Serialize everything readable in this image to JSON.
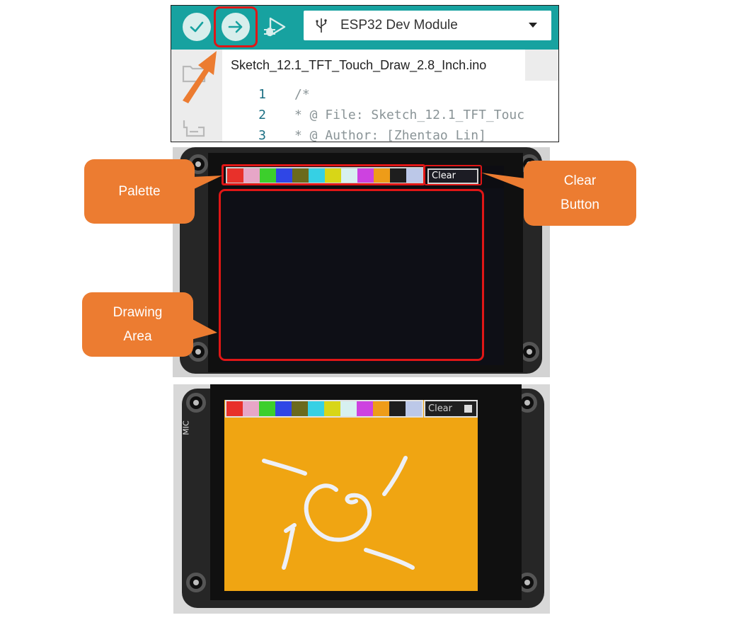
{
  "ide": {
    "board": "ESP32 Dev Module",
    "file_tab": "Sketch_12.1_TFT_Touch_Draw_2.8_Inch.ino",
    "code_lines": [
      {
        "num": "1",
        "text": "/*"
      },
      {
        "num": "2",
        "text": "* @ File:   Sketch_12.1_TFT_Touc"
      },
      {
        "num": "3",
        "text": "* @ Author: [Zhentao Lin]"
      }
    ]
  },
  "device": {
    "palette_colors": [
      "#e8302a",
      "#e7a6c7",
      "#3ccf2c",
      "#2f46e6",
      "#6b6a1c",
      "#36d0e4",
      "#d8d617",
      "#d7f0f0",
      "#cd42e0",
      "#ee9c18",
      "#1e1e1e",
      "#bcc8e8"
    ],
    "clear_label": "Clear",
    "mic_label": "MIC",
    "drawing_color": "#f0a512",
    "ink_color": "#eef0f6"
  },
  "callouts": {
    "palette": "Palette",
    "clear_line1": "Clear",
    "clear_line2": "Button",
    "drawing_line1": "Drawing",
    "drawing_line2": "Area"
  },
  "colors": {
    "toolbar": "#17a2a0",
    "callout": "#ec7c31",
    "highlight": "#e01616"
  }
}
